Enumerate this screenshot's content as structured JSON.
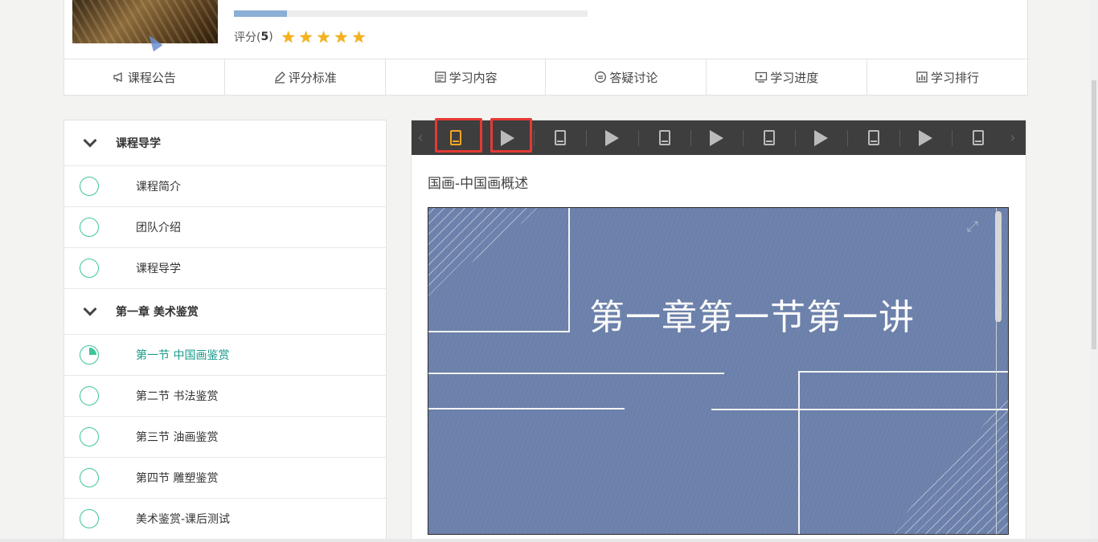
{
  "header": {
    "progress_percent": 15,
    "rating_label": "评分(",
    "rating_value": "5",
    "rating_close": ")",
    "stars": 5
  },
  "nav": {
    "items": [
      {
        "label": "课程公告",
        "icon": "megaphone-icon"
      },
      {
        "label": "评分标准",
        "icon": "pen-icon"
      },
      {
        "label": "学习内容",
        "icon": "content-icon"
      },
      {
        "label": "答疑讨论",
        "icon": "chat-icon"
      },
      {
        "label": "学习进度",
        "icon": "progress-icon"
      },
      {
        "label": "学习排行",
        "icon": "ranking-icon"
      }
    ]
  },
  "sidebar": {
    "chapter1": "课程导学",
    "ch1_items": [
      "课程简介",
      "团队介绍",
      "课程导学"
    ],
    "chapter2": "第一章 美术鉴赏",
    "ch2_items": [
      "第一节 中国画鉴赏",
      "第二节 书法鉴赏",
      "第三节 油画鉴赏",
      "第四节 雕塑鉴赏",
      "美术鉴赏-课后测试"
    ]
  },
  "content": {
    "title": "国画-中国画概述",
    "slide_text": "第一章第一节第一讲",
    "toolbar_items": [
      "doc",
      "play",
      "doc",
      "play",
      "doc",
      "play",
      "doc",
      "play",
      "doc",
      "play",
      "doc"
    ]
  },
  "colors": {
    "accent_green": "#3ec49b",
    "active_text": "#1a9a8a",
    "highlight_red": "#e53935",
    "selected_doc": "#f5a623",
    "star": "#f7b21b"
  }
}
